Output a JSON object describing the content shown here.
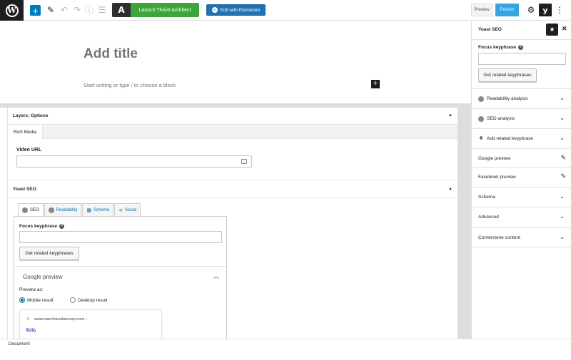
{
  "toolbar": {
    "thrive_label": "Launch Thrive Architect",
    "elementor_label": "Edit with Elementor",
    "preview_label": "Preview",
    "publish_label": "Publish"
  },
  "editor": {
    "title_placeholder": "Add title",
    "block_placeholder": "Start writing or type / to choose a block"
  },
  "layers_box": {
    "title": "Layers: Options",
    "tab": "Rich Media",
    "video_label": "Video URL"
  },
  "yoast_box": {
    "title": "Yoast SEO",
    "tabs": [
      "SEO",
      "Readability",
      "Schema",
      "Social"
    ],
    "focus_label": "Focus keyphrase",
    "related_button": "Get related keyphrases",
    "google_preview": "Google preview",
    "preview_as": "Preview as:",
    "mobile_result": "Mobile result",
    "desktop_result": "Desktop result",
    "snippet_url": "www.marchianolawcorp.com ›",
    "snippet_title": "%%"
  },
  "sidebar": {
    "title": "Yoast SEO",
    "focus_label": "Focus keyphrase",
    "related_button": "Get related keyphrases",
    "rows": [
      "Readability analysis",
      "SEO analysis",
      "Add related keyphrase",
      "Google preview",
      "Facebook preview",
      "Schema",
      "Advanced",
      "Cornerstone content"
    ]
  },
  "footer": {
    "document": "Document"
  },
  "colors": {
    "wp_primary": "#007cba",
    "thrive_green": "#3ba73b",
    "elementor_blue": "#2272b1",
    "publish_blue": "#33a5e2",
    "link_blue": "#0073aa"
  }
}
